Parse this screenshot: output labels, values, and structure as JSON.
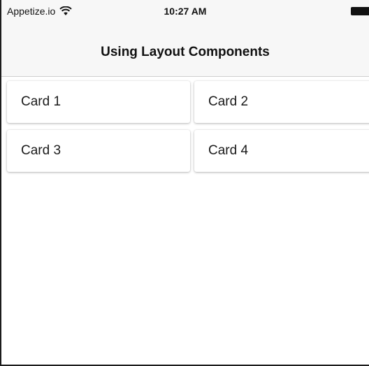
{
  "status_bar": {
    "carrier": "Appetize.io",
    "time": "10:27 AM",
    "wifi_icon": "wifi-icon",
    "battery_icon": "battery-icon"
  },
  "nav_bar": {
    "title": "Using Layout Components"
  },
  "cards": [
    {
      "label": "Card 1"
    },
    {
      "label": "Card 2"
    },
    {
      "label": "Card 3"
    },
    {
      "label": "Card 4"
    }
  ],
  "colors": {
    "bar_background": "#f7f7f7",
    "card_background": "#ffffff",
    "text": "#1a1a1a"
  }
}
